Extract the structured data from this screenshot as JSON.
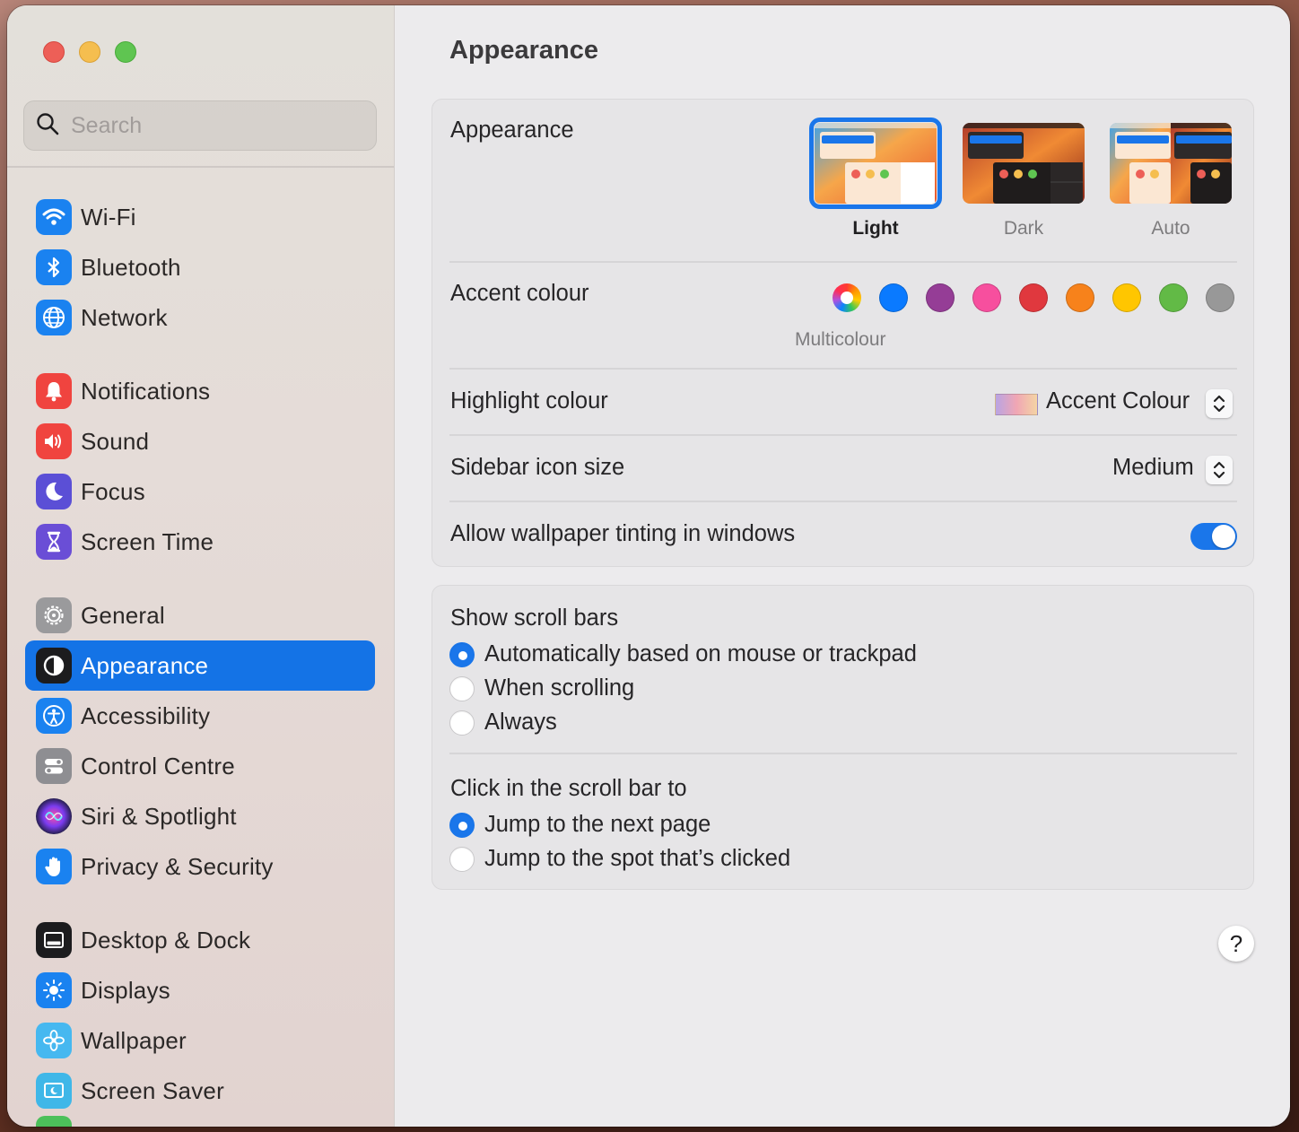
{
  "window": {
    "traffic_lights": [
      "close",
      "minimize",
      "zoom"
    ]
  },
  "search": {
    "placeholder": "Search"
  },
  "sidebar": {
    "items": [
      {
        "label": "Wi-Fi",
        "icon": "wifi-icon",
        "color": "#1a82f0"
      },
      {
        "label": "Bluetooth",
        "icon": "bluetooth-icon",
        "color": "#1a82f0"
      },
      {
        "label": "Network",
        "icon": "globe-icon",
        "color": "#1a82f0"
      },
      {
        "label": "Notifications",
        "icon": "bell-icon",
        "color": "#f0443f"
      },
      {
        "label": "Sound",
        "icon": "speaker-icon",
        "color": "#f0443f"
      },
      {
        "label": "Focus",
        "icon": "moon-icon",
        "color": "#5b4fd6"
      },
      {
        "label": "Screen Time",
        "icon": "hourglass-icon",
        "color": "#6a4ed6"
      },
      {
        "label": "General",
        "icon": "gear-icon",
        "color": "#9a9a9c"
      },
      {
        "label": "Appearance",
        "icon": "appearance-icon",
        "color": "#1c1c1e"
      },
      {
        "label": "Accessibility",
        "icon": "accessibility-icon",
        "color": "#1a82f0"
      },
      {
        "label": "Control Centre",
        "icon": "toggles-icon",
        "color": "#8e8e92"
      },
      {
        "label": "Siri & Spotlight",
        "icon": "siri-icon",
        "color": "#2a2a40"
      },
      {
        "label": "Privacy & Security",
        "icon": "hand-icon",
        "color": "#1a82f0"
      },
      {
        "label": "Desktop & Dock",
        "icon": "dock-icon",
        "color": "#1c1c1e"
      },
      {
        "label": "Displays",
        "icon": "sun-icon",
        "color": "#1a82f0"
      },
      {
        "label": "Wallpaper",
        "icon": "flower-icon",
        "color": "#46b8f0"
      },
      {
        "label": "Screen Saver",
        "icon": "screensaver-icon",
        "color": "#3fb7e8"
      }
    ],
    "selected": "Appearance"
  },
  "main": {
    "title": "Appearance",
    "appearance": {
      "label": "Appearance",
      "options": [
        "Light",
        "Dark",
        "Auto"
      ],
      "selected": "Light"
    },
    "accent": {
      "label": "Accent colour",
      "caption": "Multicolour",
      "colors": [
        "multicolour",
        "#0a7aff",
        "#953d96",
        "#f74f9e",
        "#e0383e",
        "#f7821b",
        "#ffc600",
        "#62ba46",
        "#989898"
      ],
      "selected": "multicolour"
    },
    "highlight": {
      "label": "Highlight colour",
      "value": "Accent Colour"
    },
    "sidebar_icon_size": {
      "label": "Sidebar icon size",
      "value": "Medium"
    },
    "wallpaper_tinting": {
      "label": "Allow wallpaper tinting in windows",
      "enabled": true
    },
    "scroll_bars": {
      "title": "Show scroll bars",
      "options": [
        "Automatically based on mouse or trackpad",
        "When scrolling",
        "Always"
      ],
      "selected": 0
    },
    "click_scroll": {
      "title": "Click in the scroll bar to",
      "options": [
        "Jump to the next page",
        "Jump to the spot that’s clicked"
      ],
      "selected": 0
    },
    "help_label": "?"
  }
}
